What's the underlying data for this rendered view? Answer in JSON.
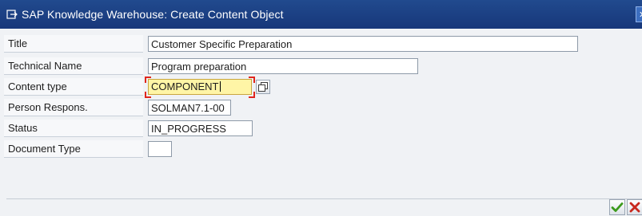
{
  "window": {
    "title": "SAP Knowledge Warehouse: Create Content Object"
  },
  "form": {
    "title": {
      "label": "Title",
      "value": "Customer Specific Preparation"
    },
    "technical_name": {
      "label": "Technical Name",
      "value": "Program preparation"
    },
    "content_type": {
      "label": "Content type",
      "value": "COMPONENT"
    },
    "person_responsible": {
      "label": "Person Respons.",
      "value": "SOLMAN7.1-00"
    },
    "status": {
      "label": "Status",
      "value": "IN_PROGRESS"
    },
    "document_type": {
      "label": "Document Type",
      "value": ""
    }
  },
  "icons": {
    "title": "sap-window-icon",
    "value_help": "value-help-icon",
    "confirm": "checkmark-icon",
    "cancel": "cross-icon",
    "close": "close-icon"
  },
  "colors": {
    "titlebar": "#17377a",
    "focused_field": "#fff5a6",
    "focus_frame": "#e0261d",
    "confirm": "#3c9a1c",
    "cancel": "#c8281e"
  }
}
